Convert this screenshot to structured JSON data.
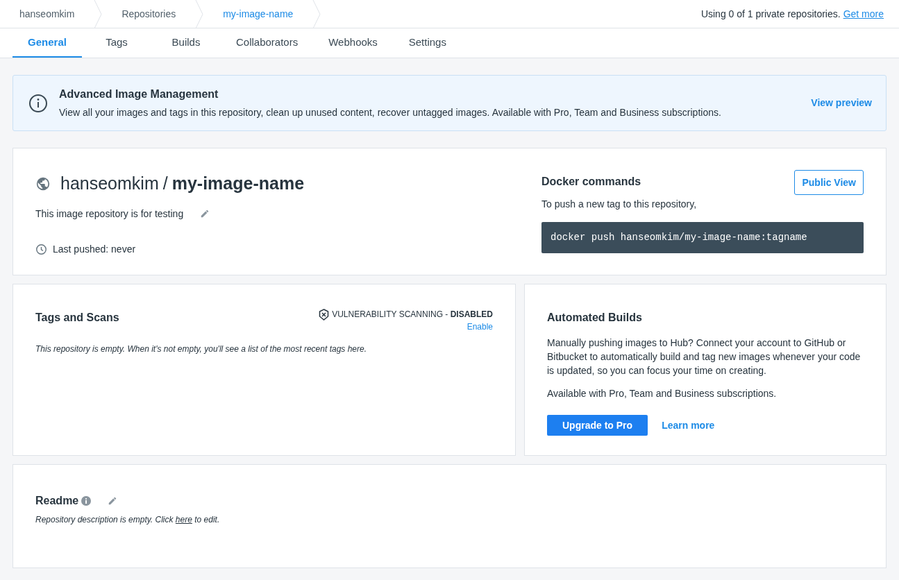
{
  "breadcrumbs": [
    {
      "label": "hanseomkim",
      "current": false
    },
    {
      "label": "Repositories",
      "current": false
    },
    {
      "label": "my-image-name",
      "current": true
    }
  ],
  "usage": {
    "text": "Using 0 of 1 private repositories.",
    "link": "Get more"
  },
  "tabs": [
    {
      "label": "General",
      "selected": true
    },
    {
      "label": "Tags",
      "selected": false
    },
    {
      "label": "Builds",
      "selected": false
    },
    {
      "label": "Collaborators",
      "selected": false
    },
    {
      "label": "Webhooks",
      "selected": false
    },
    {
      "label": "Settings",
      "selected": false
    }
  ],
  "banner": {
    "title": "Advanced Image Management",
    "text": "View all your images and tags in this repository, clean up unused content, recover untagged images. Available with Pro, Team and Business subscriptions.",
    "link": "View preview"
  },
  "repository": {
    "owner": "hanseomkim",
    "separator": "/",
    "name": "my-image-name",
    "description": "This image repository is for testing",
    "last_pushed": "Last pushed: never"
  },
  "docker_commands": {
    "title": "Docker commands",
    "button": "Public View",
    "hint": "To push a new tag to this repository,",
    "command": "docker push hanseomkim/my-image-name:tagname"
  },
  "tags_and_scans": {
    "title": "Tags and Scans",
    "scanning": "VULNERABILITY SCANNING - **DISABLED**",
    "enable": "Enable",
    "empty": "This repository is empty. When it's not empty, you'll see a list of the most recent tags here."
  },
  "automated_builds": {
    "title": "Automated Builds",
    "text": "Manually pushing images to Hub? Connect your account to GitHub or Bitbucket to automatically build and tag new images whenever your code is updated, so you can focus your time on creating.",
    "availability": "Available with Pro, Team and Business subscriptions.",
    "primary_button": "Upgrade to Pro",
    "link": "Learn more"
  },
  "readme": {
    "title": "Readme",
    "empty_before": "Repository description is empty. Click ",
    "empty_link": "here",
    "empty_after": " to edit."
  }
}
